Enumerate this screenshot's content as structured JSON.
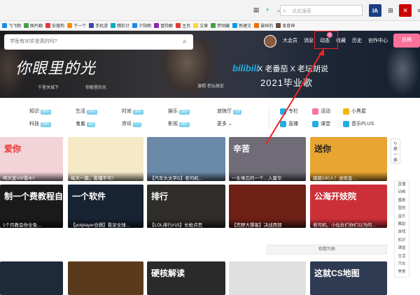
{
  "browser": {
    "search_placeholder": "点此搜索",
    "ia_label": "IA",
    "grid_icon": "⊞",
    "close_icon": "✕",
    "more_icon": "≡"
  },
  "bookmarks": [
    {
      "label": "飞飞物",
      "color": "#1e88e5"
    },
    {
      "label": "图片翻",
      "color": "#43a047"
    },
    {
      "label": "安搜狗",
      "color": "#e53935"
    },
    {
      "label": "下一个",
      "color": "#fb8c00"
    },
    {
      "label": "手机游",
      "color": "#3949ab"
    },
    {
      "label": "精彩计",
      "color": "#00acc1"
    },
    {
      "label": "夕阳物",
      "color": "#1e88e5"
    },
    {
      "label": "冒险解",
      "color": "#8e24aa"
    },
    {
      "label": "主页",
      "color": "#e53935"
    },
    {
      "label": "文章",
      "color": "#fdd835"
    },
    {
      "label": "梦回藏",
      "color": "#43a047"
    },
    {
      "label": "新建文",
      "color": "#039be5"
    },
    {
      "label": "破碎的",
      "color": "#ef6c00"
    },
    {
      "label": "发育神",
      "color": "#6d4c41"
    }
  ],
  "header": {
    "search_placeholder": "学医有30岁是真的吗?",
    "nav": [
      "大会员",
      "消息",
      "动态",
      "收藏",
      "历史",
      "创作中心"
    ],
    "upload": "投稿",
    "badge": "5"
  },
  "banner": {
    "title": "你眼里的光",
    "sub1": "千里关城下",
    "sub2": "你眼里的光",
    "credit": "演唱 老坛胡说",
    "logo": "bilibili",
    "collab": "X 老番茄 X 老坛胡说",
    "year_song": "2021毕业歌"
  },
  "categories": [
    {
      "label": "知识",
      "count": "999+"
    },
    {
      "label": "生活",
      "count": "999+"
    },
    {
      "label": "时尚",
      "count": "999+"
    },
    {
      "label": "娱乐",
      "count": "999+"
    },
    {
      "label": "放映厅",
      "count": "199"
    },
    {
      "label": "科技",
      "count": "999+"
    },
    {
      "label": "鬼畜",
      "count": "182"
    },
    {
      "label": "资讯",
      "count": "777"
    },
    {
      "label": "影视",
      "count": "999+"
    },
    {
      "label": "更多",
      "count": ""
    }
  ],
  "special": [
    {
      "label": "专栏",
      "color": "#23ade5"
    },
    {
      "label": "活动",
      "color": "#fb7299"
    },
    {
      "label": "小黑屋",
      "color": "#f7b500"
    },
    {
      "label": "直播",
      "color": "#23ade5"
    },
    {
      "label": "课堂",
      "color": "#23ade5"
    },
    {
      "label": "音乐PLUS",
      "color": "#23ade5"
    }
  ],
  "videos_row1": [
    {
      "caption": "明天爱VIP看中！",
      "big": "爱你",
      "bg": "#f2d3d8"
    },
    {
      "caption": "每天一篇，看懂不可！",
      "big": "",
      "bg": "#f6e9c8"
    },
    {
      "caption": "【汽车头文字D】老司机…",
      "big": "",
      "bg": "#6a89a8"
    },
    {
      "caption": "一生难忘的一个…入夏华",
      "big": "辛苦",
      "bg": "#6f6c77"
    },
    {
      "caption": "踏踏100人！送现金…",
      "big": "送你",
      "bg": "#e8a531"
    }
  ],
  "videos_row2": [
    {
      "caption": "1个月教会你全免…",
      "big": "制一个费教程自学网",
      "bg": "#1a1a1a"
    },
    {
      "caption": "【potplayer合辑】看足全球…",
      "big": "一个软件",
      "bg": "#172232"
    },
    {
      "caption": "【LOL排行#15】长枪点荒",
      "big": "排行",
      "bg": "#2f2d2a"
    },
    {
      "caption": "【荒野大镖客】决战西部",
      "big": "",
      "bg": "#6e2016"
    },
    {
      "caption": "老司机，小仙女们你们以为的…",
      "big": "公海开妓院",
      "bg": "#cc3037"
    }
  ],
  "videos_row3": [
    {
      "caption": "",
      "big": "",
      "bg": "#1d2a3a"
    },
    {
      "caption": "",
      "big": "",
      "bg": "#5a3a1c"
    },
    {
      "caption": "",
      "big": "硬核解读",
      "bg": "#2a2a2a"
    },
    {
      "caption": "",
      "big": "",
      "bg": "#e0e0e0"
    },
    {
      "caption": "",
      "big": "这就CS地图",
      "bg": "#2f3b52"
    }
  ],
  "refresh_label": "换一换",
  "watch_list": "观看列表",
  "side_nav": [
    "直播",
    "动画",
    "番剧",
    "国创",
    "音乐",
    "舞蹈",
    "游戏",
    "知识",
    "课堂",
    "生活",
    "汽车",
    "美食"
  ]
}
